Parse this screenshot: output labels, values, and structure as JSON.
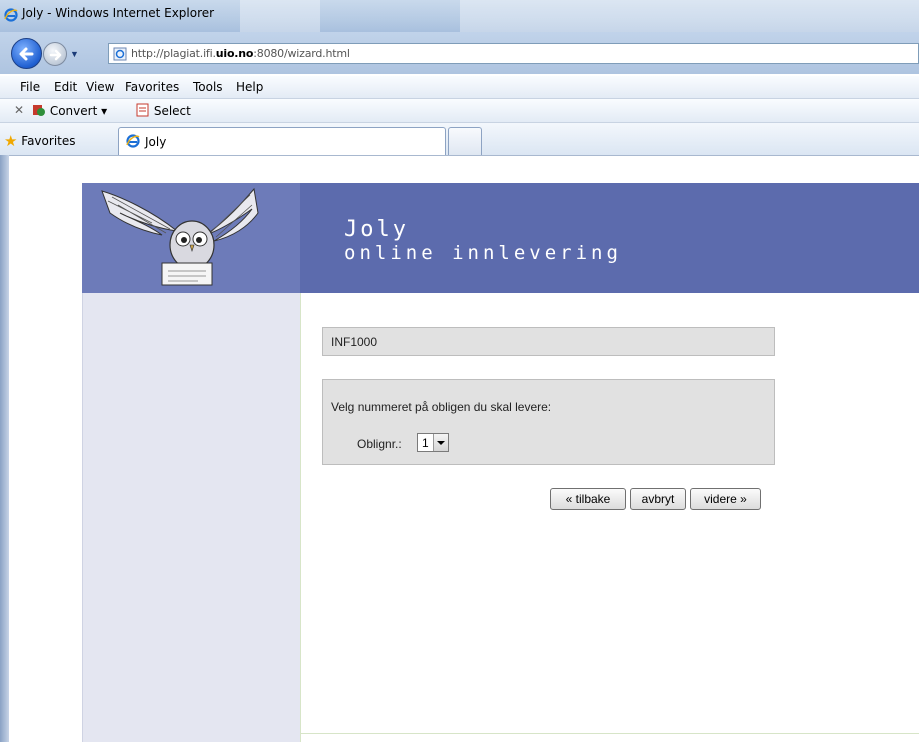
{
  "window": {
    "title": "Joly - Windows Internet Explorer"
  },
  "address": {
    "url_prefix": "http://plagiat.ifi.",
    "url_domain": "uio.no",
    "url_suffix": ":8080/wizard.html"
  },
  "menu": [
    "File",
    "Edit",
    "View",
    "Favorites",
    "Tools",
    "Help"
  ],
  "commandbar": {
    "convert_label": "Convert",
    "select_label": "Select"
  },
  "favorites": {
    "label": "Favorites",
    "tab_title": "Joly"
  },
  "banner": {
    "title": "Joly",
    "subtitle": "online innlevering"
  },
  "wizard": {
    "course": "INF1000",
    "prompt": "Velg nummeret på obligen du skal levere:",
    "oblig_label": "Oblignr.:",
    "oblig_value": "1",
    "back_label": "« tilbake",
    "cancel_label": "avbryt",
    "next_label": "videre »"
  }
}
